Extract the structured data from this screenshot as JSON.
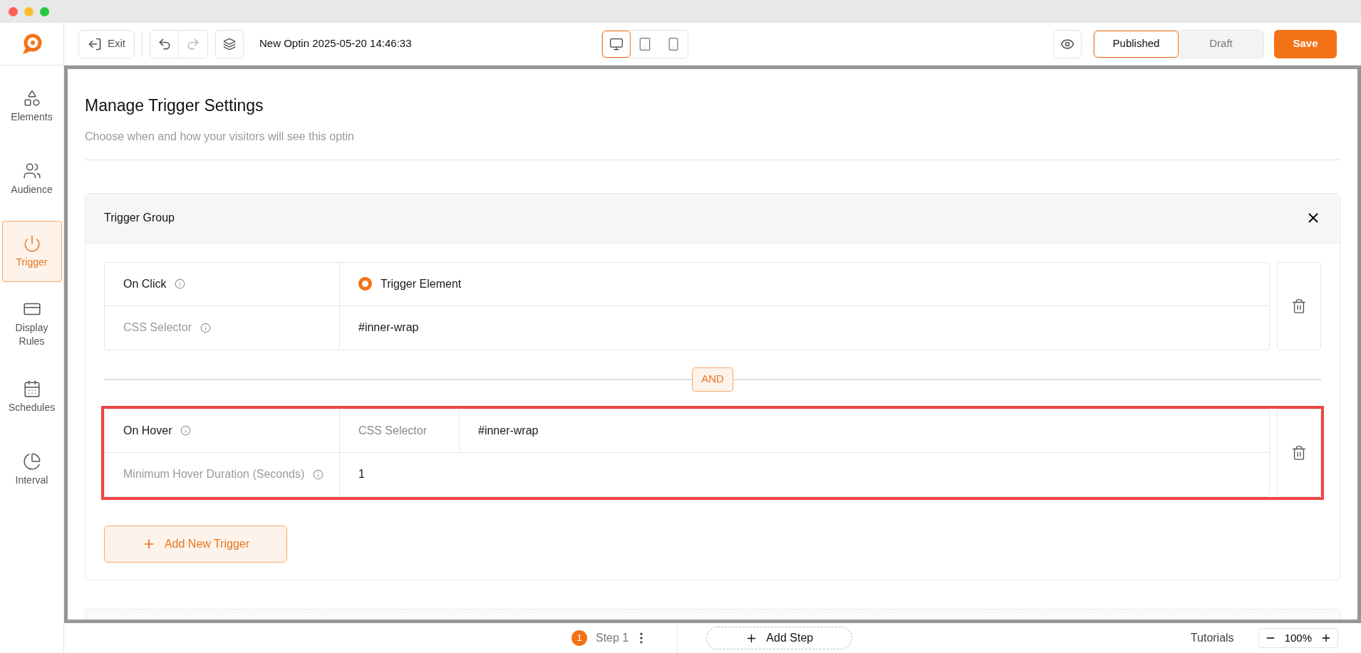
{
  "toolbar": {
    "exit": "Exit",
    "title": "New Optin 2025-05-20 14:46:33",
    "devices": [
      {
        "kind": "desktop",
        "selected": true
      },
      {
        "kind": "tablet",
        "selected": false
      },
      {
        "kind": "mobile",
        "selected": false
      }
    ],
    "status": [
      {
        "label": "Published",
        "selected": true
      },
      {
        "label": "Draft",
        "selected": false
      }
    ],
    "save": "Save"
  },
  "sidebar": {
    "items": [
      {
        "kind": "elements",
        "label": "Elements",
        "selected": false
      },
      {
        "kind": "audience",
        "label": "Audience",
        "selected": false
      },
      {
        "kind": "trigger",
        "label": "Trigger",
        "selected": true
      },
      {
        "kind": "display",
        "label": "Display Rules",
        "selected": false
      },
      {
        "kind": "schedules",
        "label": "Schedules",
        "selected": false
      },
      {
        "kind": "interval",
        "label": "Interval",
        "selected": false
      }
    ]
  },
  "page": {
    "title": "Manage Trigger Settings",
    "subtitle": "Choose when and how your visitors will see this optin"
  },
  "trigger_group": {
    "title": "Trigger Group",
    "connector": "AND",
    "add_button": "Add New Trigger",
    "triggers": [
      {
        "highlighted": false,
        "rows": [
          {
            "kind": "radio",
            "label": "On Click",
            "option": "Trigger Element",
            "checked": true
          },
          {
            "kind": "value",
            "label": "CSS Selector",
            "value": "#inner-wrap"
          }
        ]
      },
      {
        "highlighted": true,
        "rows": [
          {
            "kind": "field",
            "label": "On Hover",
            "field_label": "CSS Selector",
            "value": "#inner-wrap"
          },
          {
            "kind": "value",
            "label": "Minimum Hover Duration (Seconds)",
            "value": "1"
          }
        ]
      }
    ]
  },
  "bottom_bar": {
    "step_number": "1",
    "step_label": "Step 1",
    "add_step": "Add Step",
    "tutorials": "Tutorials",
    "zoom": "100%"
  }
}
